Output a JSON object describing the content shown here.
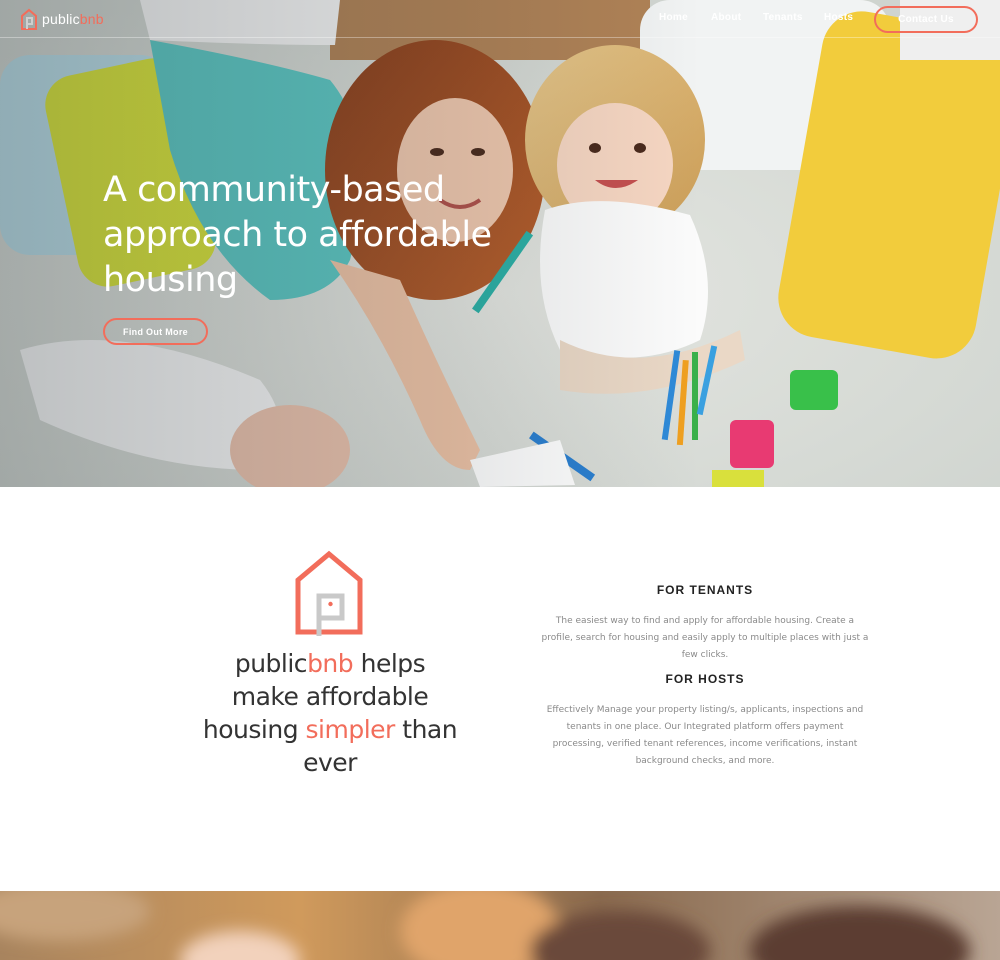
{
  "brand": {
    "name_part1": "public",
    "name_part2": "bnb",
    "accent_color": "#f26d5b"
  },
  "nav": {
    "links": [
      {
        "label": "Home"
      },
      {
        "label": "About"
      },
      {
        "label": "Tenants"
      },
      {
        "label": "Hosts"
      }
    ],
    "contact_label": "Contact Us"
  },
  "hero": {
    "title": "A community-based approach to affordable housing",
    "cta_label": "Find Out More",
    "image_subject": "mother-and-children-on-carpet-photo"
  },
  "info": {
    "tagline": {
      "part1": "public",
      "part2": "bnb",
      "part3": " helps make affordable housing ",
      "part4": "simpler",
      "part5": " than ever"
    },
    "tenants": {
      "heading": "FOR TENANTS",
      "body": "The easiest way to find and apply for affordable housing. Create a profile, search for housing and easily apply to multiple places with just a few clicks."
    },
    "hosts": {
      "heading": "FOR HOSTS",
      "body": "Effectively Manage your property listing/s, applicants, inspections and tenants in one place. Our Integrated platform offers payment processing, verified tenant references, income verifications, instant background checks, and more."
    }
  },
  "strip": {
    "image_subject": "blurred-people-photo"
  }
}
